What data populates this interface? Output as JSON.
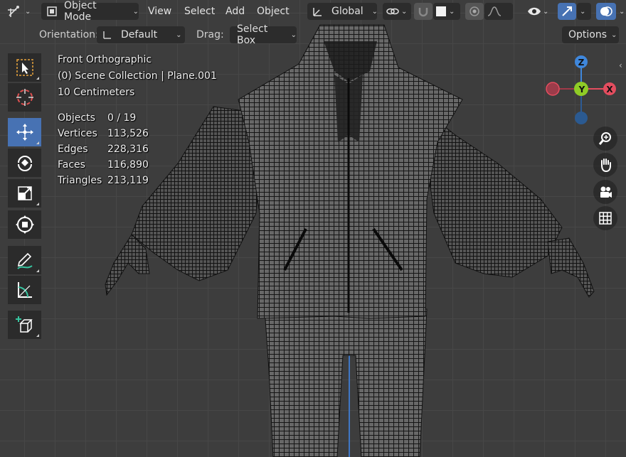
{
  "header": {
    "mode": "Object Mode",
    "menus": [
      "View",
      "Select",
      "Add",
      "Object"
    ],
    "transform_orientation": "Global"
  },
  "tool_header": {
    "orientation_label": "Orientation:",
    "orientation_value": "Default",
    "drag_label": "Drag:",
    "drag_value": "Select Box",
    "options": "Options"
  },
  "overlay": {
    "view_name": "Front Orthographic",
    "collection": "(0) Scene Collection | Plane.001",
    "scale": "10 Centimeters",
    "stats": [
      {
        "label": "Objects",
        "value": "0 / 19"
      },
      {
        "label": "Vertices",
        "value": "113,526"
      },
      {
        "label": "Edges",
        "value": "228,316"
      },
      {
        "label": "Faces",
        "value": "116,890"
      },
      {
        "label": "Triangles",
        "value": "213,119"
      }
    ]
  },
  "gizmo": {
    "z": "Z",
    "y": "Y",
    "x": "X"
  },
  "colors": {
    "accent": "#4772b3",
    "x_axis": "#e44d5f",
    "y_axis": "#8fcc26",
    "z_axis": "#3f87dc"
  },
  "icons": [
    "cursor-select-icon",
    "3d-cursor-icon",
    "move-icon",
    "rotate-icon",
    "scale-icon",
    "transform-icon",
    "annotate-icon",
    "measure-icon",
    "add-cube-icon",
    "zoom-icon",
    "hand-icon",
    "camera-icon",
    "grid-icon"
  ]
}
